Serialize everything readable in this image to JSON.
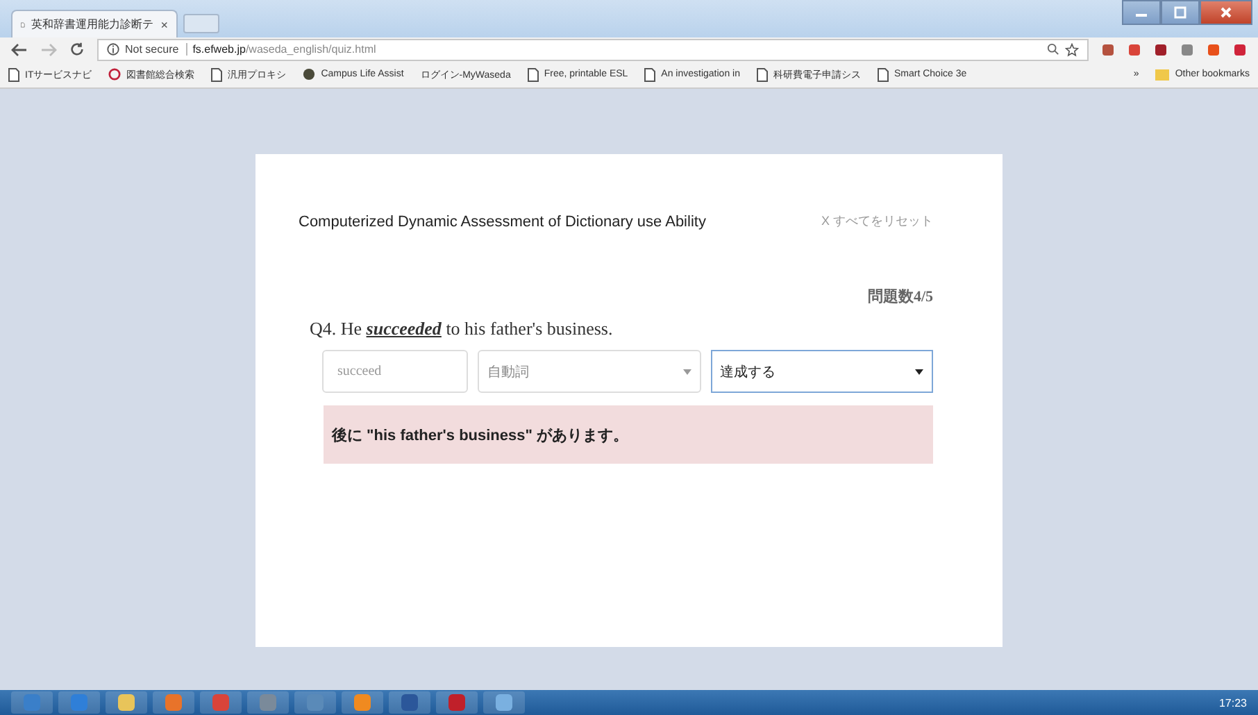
{
  "browser": {
    "tab": {
      "title": "英和辞書運用能力診断テ",
      "close": "×"
    },
    "address": {
      "security": "Not secure",
      "host": "fs.efweb.jp",
      "path": "/waseda_english/quiz.html"
    },
    "bookmarks": [
      {
        "label": "ITサービスナビ",
        "kind": "page"
      },
      {
        "label": "図書館総合検索",
        "kind": "library"
      },
      {
        "label": "汎用プロキシ",
        "kind": "page"
      },
      {
        "label": "Campus Life Assist",
        "kind": "globe"
      },
      {
        "label": "ログイン-MyWaseda",
        "kind": "none"
      },
      {
        "label": "Free, printable ESL",
        "kind": "page"
      },
      {
        "label": "An investigation in",
        "kind": "page"
      },
      {
        "label": "科研費電子申請シス",
        "kind": "page"
      },
      {
        "label": "Smart Choice 3e",
        "kind": "page"
      }
    ],
    "overflow": "»",
    "other_bookmarks": "Other bookmarks"
  },
  "quiz": {
    "title": "Computerized Dynamic Assessment of Dictionary use Ability",
    "reset": "X すべてをリセット",
    "counter": "問題数4/5",
    "question": {
      "before": "Q4. He ",
      "word": "succeeded",
      "after": " to his father's business."
    },
    "answer": {
      "placeholder": "succeed"
    },
    "selects": [
      {
        "value": "自動詞",
        "focused": false
      },
      {
        "value": "達成する",
        "focused": true
      }
    ],
    "feedback": "後に \"his father's business\" があります。"
  },
  "taskbar": {
    "time": "17:23"
  }
}
